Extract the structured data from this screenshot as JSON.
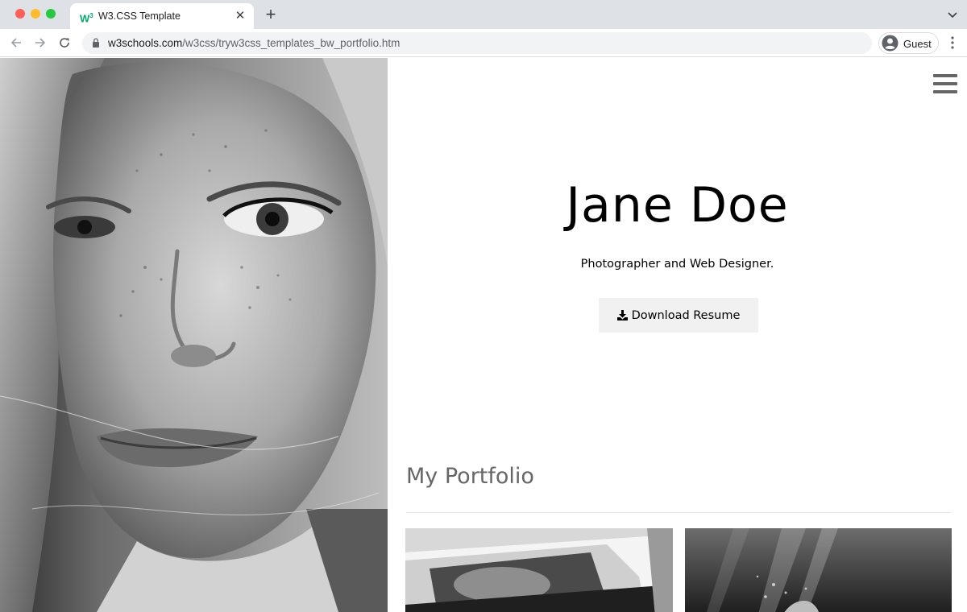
{
  "browser": {
    "tab_title": "W3.CSS Template",
    "favicon_text": "W",
    "url_host": "w3schools.com",
    "url_path": "/w3css/tryw3css_templates_bw_portfolio.htm",
    "profile_label": "Guest"
  },
  "page": {
    "name": "Jane Doe",
    "tagline": "Photographer and Web Designer.",
    "resume_button": "Download Resume",
    "portfolio_heading": "My Portfolio"
  },
  "icons": {
    "menu": "hamburger-icon",
    "download": "download-icon",
    "lock": "lock-icon",
    "back": "arrow-left-icon",
    "forward": "arrow-right-icon",
    "reload": "reload-icon",
    "profile": "account-circle-icon",
    "more": "more-vert-icon"
  },
  "colors": {
    "tabbar": "#dee1e6",
    "button_bg": "#f1f1f1",
    "heading_gray": "#666666",
    "w3_green": "#04aa6d"
  }
}
